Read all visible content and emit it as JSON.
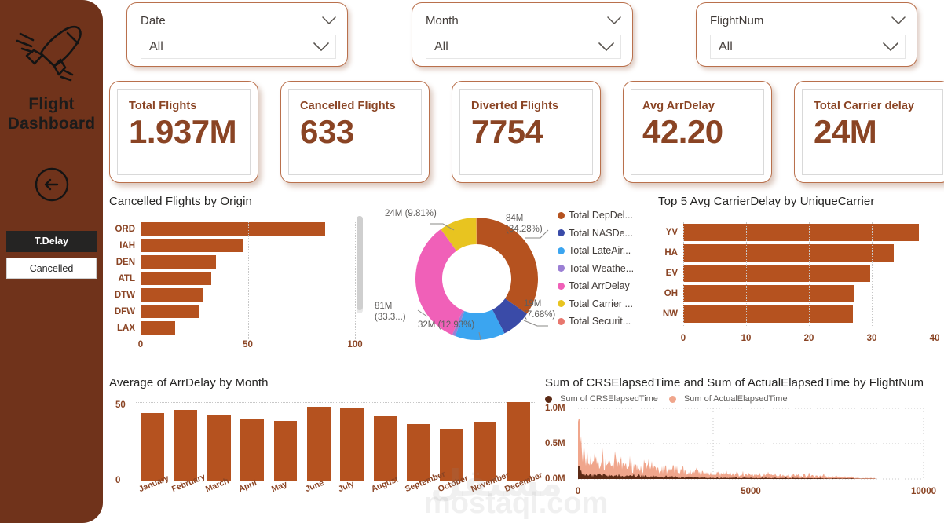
{
  "sidebar": {
    "brand_line1": "Flight",
    "brand_line2": "Dashboard",
    "plane_icon": "airplane-icon",
    "back_icon": "back-arrow-icon",
    "nav": [
      {
        "label": "T.Delay",
        "active": true
      },
      {
        "label": "Cancelled",
        "active": false
      }
    ]
  },
  "slicers": [
    {
      "title": "Date",
      "value": "All"
    },
    {
      "title": "Month",
      "value": "All"
    },
    {
      "title": "FlightNum",
      "value": "All"
    }
  ],
  "kpis": [
    {
      "label": "Total Flights",
      "value": "1.937M"
    },
    {
      "label": "Cancelled Flights",
      "value": "633"
    },
    {
      "label": "Diverted Flights",
      "value": "7754"
    },
    {
      "label": "Avg ArrDelay",
      "value": "42.20"
    },
    {
      "label": "Total Carrier delay",
      "value": "24M"
    }
  ],
  "colors": {
    "sidebar": "#70331B",
    "accent_bar": "#B5521F",
    "kpi_text": "#8A4424",
    "card_border": "#B9704C",
    "active_nav": "#252423",
    "area_light": "#F0A68C",
    "area_dark": "#5C2A15"
  },
  "watermark": {
    "arabic": "مستقل",
    "latin": "mostaql.com"
  },
  "chart_data": [
    {
      "id": "cancelled-by-origin",
      "type": "bar",
      "title": "Cancelled Flights by Origin",
      "orientation": "horizontal",
      "categories": [
        "ORD",
        "IAH",
        "DEN",
        "ATL",
        "DTW",
        "DFW",
        "LAX"
      ],
      "values": [
        86,
        48,
        35,
        33,
        29,
        27,
        16
      ],
      "xlabel": "",
      "ylabel": "",
      "xlim": [
        0,
        100
      ],
      "xticks": [
        "0",
        "50",
        "100"
      ],
      "grid": true,
      "has_scrollbar": true,
      "legend": "none"
    },
    {
      "id": "delay-breakdown-donut",
      "type": "pie",
      "subtype": "donut",
      "title": "",
      "slices": [
        {
          "name": "Total DepDel...",
          "full_name": "Total DepDelay",
          "label": "84M\n(34.28%)",
          "value": 84,
          "percent": 34.28,
          "color": "#B5521F"
        },
        {
          "name": "Total NASDe...",
          "full_name": "Total NASDelay",
          "label": "19M\n(7.68%)",
          "value": 19,
          "percent": 7.68,
          "color": "#3A4BA8"
        },
        {
          "name": "Total LateAir...",
          "full_name": "Total LateAircraftDelay",
          "label": "32M (12.93%)",
          "value": 32,
          "percent": 12.93,
          "color": "#3BA5F0"
        },
        {
          "name": "Total Weathe...",
          "full_name": "Total WeatherDelay",
          "label": "",
          "value": 2,
          "percent": 0.8,
          "color": "#9B7FD4"
        },
        {
          "name": "Total ArrDelay",
          "full_name": "Total ArrDelay",
          "label": "81M\n(33.3...)",
          "value": 81,
          "percent": 33.3,
          "color": "#F060B8"
        },
        {
          "name": "Total Carrier ...",
          "full_name": "Total Carrier delay",
          "label": "24M (9.81%)",
          "value": 24,
          "percent": 9.81,
          "color": "#E8C420"
        },
        {
          "name": "Total Securit...",
          "full_name": "Total SecurityDelay",
          "label": "",
          "value": 0.2,
          "percent": 0.1,
          "color": "#E8776E"
        }
      ],
      "legend_position": "right"
    },
    {
      "id": "top5-carrier-delay",
      "type": "bar",
      "title": "Top 5 Avg CarrierDelay by UniqueCarrier",
      "orientation": "horizontal",
      "categories": [
        "YV",
        "HA",
        "EV",
        "OH",
        "NW"
      ],
      "values": [
        37.5,
        33.5,
        29.8,
        27.2,
        27.0
      ],
      "xlim": [
        0,
        40
      ],
      "xticks": [
        "0",
        "10",
        "20",
        "30",
        "40"
      ],
      "grid": true,
      "legend": "none"
    },
    {
      "id": "avg-arrdelay-by-month",
      "type": "bar",
      "title": "Average of ArrDelay by Month",
      "orientation": "vertical",
      "categories": [
        "January",
        "February",
        "March",
        "April",
        "May",
        "June",
        "July",
        "August",
        "September",
        "October",
        "November",
        "December"
      ],
      "values": [
        43,
        45,
        42,
        39,
        38,
        47,
        46,
        41,
        36,
        33,
        37,
        50
      ],
      "ylim": [
        0,
        50
      ],
      "yticks": [
        "0",
        "50"
      ],
      "grid": true,
      "legend": "none"
    },
    {
      "id": "elapsed-time-by-flightnum",
      "type": "area",
      "title": "Sum of CRSElapsedTime and Sum of ActualElapsedTime by FlightNum",
      "xlabel": "",
      "ylabel": "",
      "xlim": [
        0,
        10000
      ],
      "ylim": [
        0,
        1000000
      ],
      "xticks": [
        "0",
        "5000",
        "10000"
      ],
      "yticks": [
        "0.0M",
        "0.5M",
        "1.0M"
      ],
      "grid": true,
      "legend_position": "top",
      "series": [
        {
          "name": "Sum of CRSElapsedTime",
          "color": "#5C2A15",
          "peak": 0.2,
          "decay": "sharp"
        },
        {
          "name": "Sum of ActualElapsedTime",
          "color": "#F0A68C",
          "peak": 0.88,
          "decay": "sharp"
        }
      ]
    }
  ]
}
